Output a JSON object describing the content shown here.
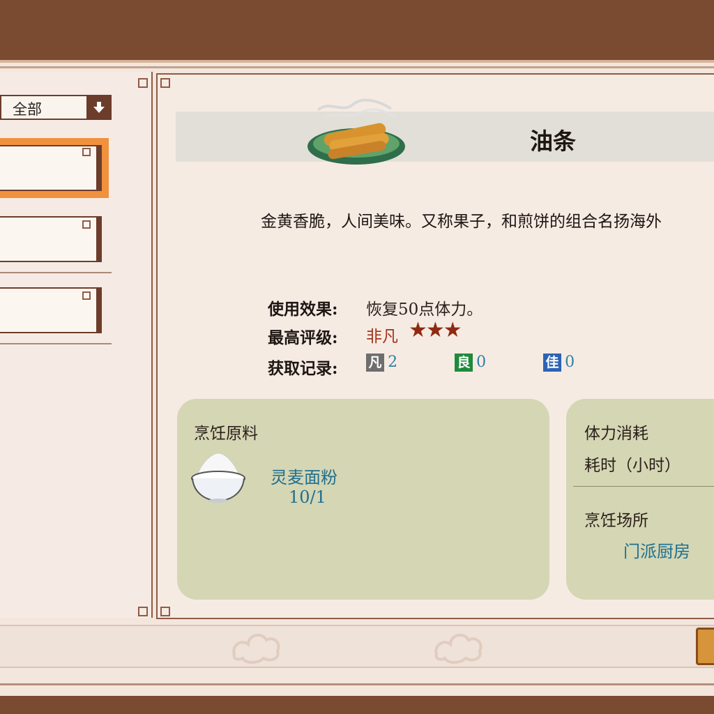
{
  "filter": {
    "selected": "全部"
  },
  "item": {
    "name": "油条",
    "description": "金黄香脆，人间美味。又称果子，和煎饼的组合名扬海外",
    "effect_label": "使用效果:",
    "effect_value": "恢复50点体力。",
    "rating_label": "最高评级:",
    "rating_value": "非凡",
    "rating_stars": "★★★",
    "record_label": "获取记录:",
    "records": [
      {
        "badge": "凡",
        "count": "2",
        "color": "#6e6e6e"
      },
      {
        "badge": "良",
        "count": "0",
        "color": "#1f8a3a"
      },
      {
        "badge": "佳",
        "count": "0",
        "color": "#2c63b5"
      }
    ]
  },
  "ingredients": {
    "title": "烹饪原料",
    "items": [
      {
        "name": "灵麦面粉",
        "amount": "10/1",
        "icon": "flour-bowl-icon"
      }
    ]
  },
  "info": {
    "stamina_label": "体力消耗",
    "time_label": "耗时（小时）",
    "place_label": "烹饪场所",
    "place_value": "门派厨房"
  },
  "colors": {
    "accent": "#f1913e",
    "frame": "#7a4a31",
    "card": "#d5d6b4",
    "link": "#1f6f8f"
  }
}
